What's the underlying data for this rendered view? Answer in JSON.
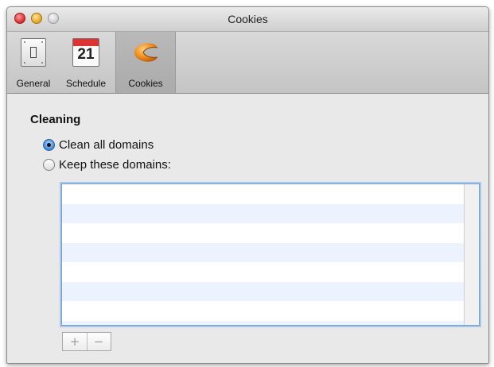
{
  "window": {
    "title": "Cookies"
  },
  "toolbar": {
    "items": [
      {
        "label": "General",
        "icon": "switch-icon"
      },
      {
        "label": "Schedule",
        "icon": "calendar-icon",
        "calendar_day": "21"
      },
      {
        "label": "Cookies",
        "icon": "fortune-cookie-icon",
        "selected": true
      }
    ]
  },
  "cleaning": {
    "section_title": "Cleaning",
    "options": [
      {
        "label": "Clean all domains",
        "selected": true
      },
      {
        "label": "Keep these domains:",
        "selected": false
      }
    ],
    "domains": []
  },
  "list_buttons": {
    "add": "+",
    "remove": "−"
  },
  "colors": {
    "list_focus_ring": "#a9c6ea",
    "radio_selected": "#3b86d6",
    "calendar_header": "#dd3333"
  }
}
